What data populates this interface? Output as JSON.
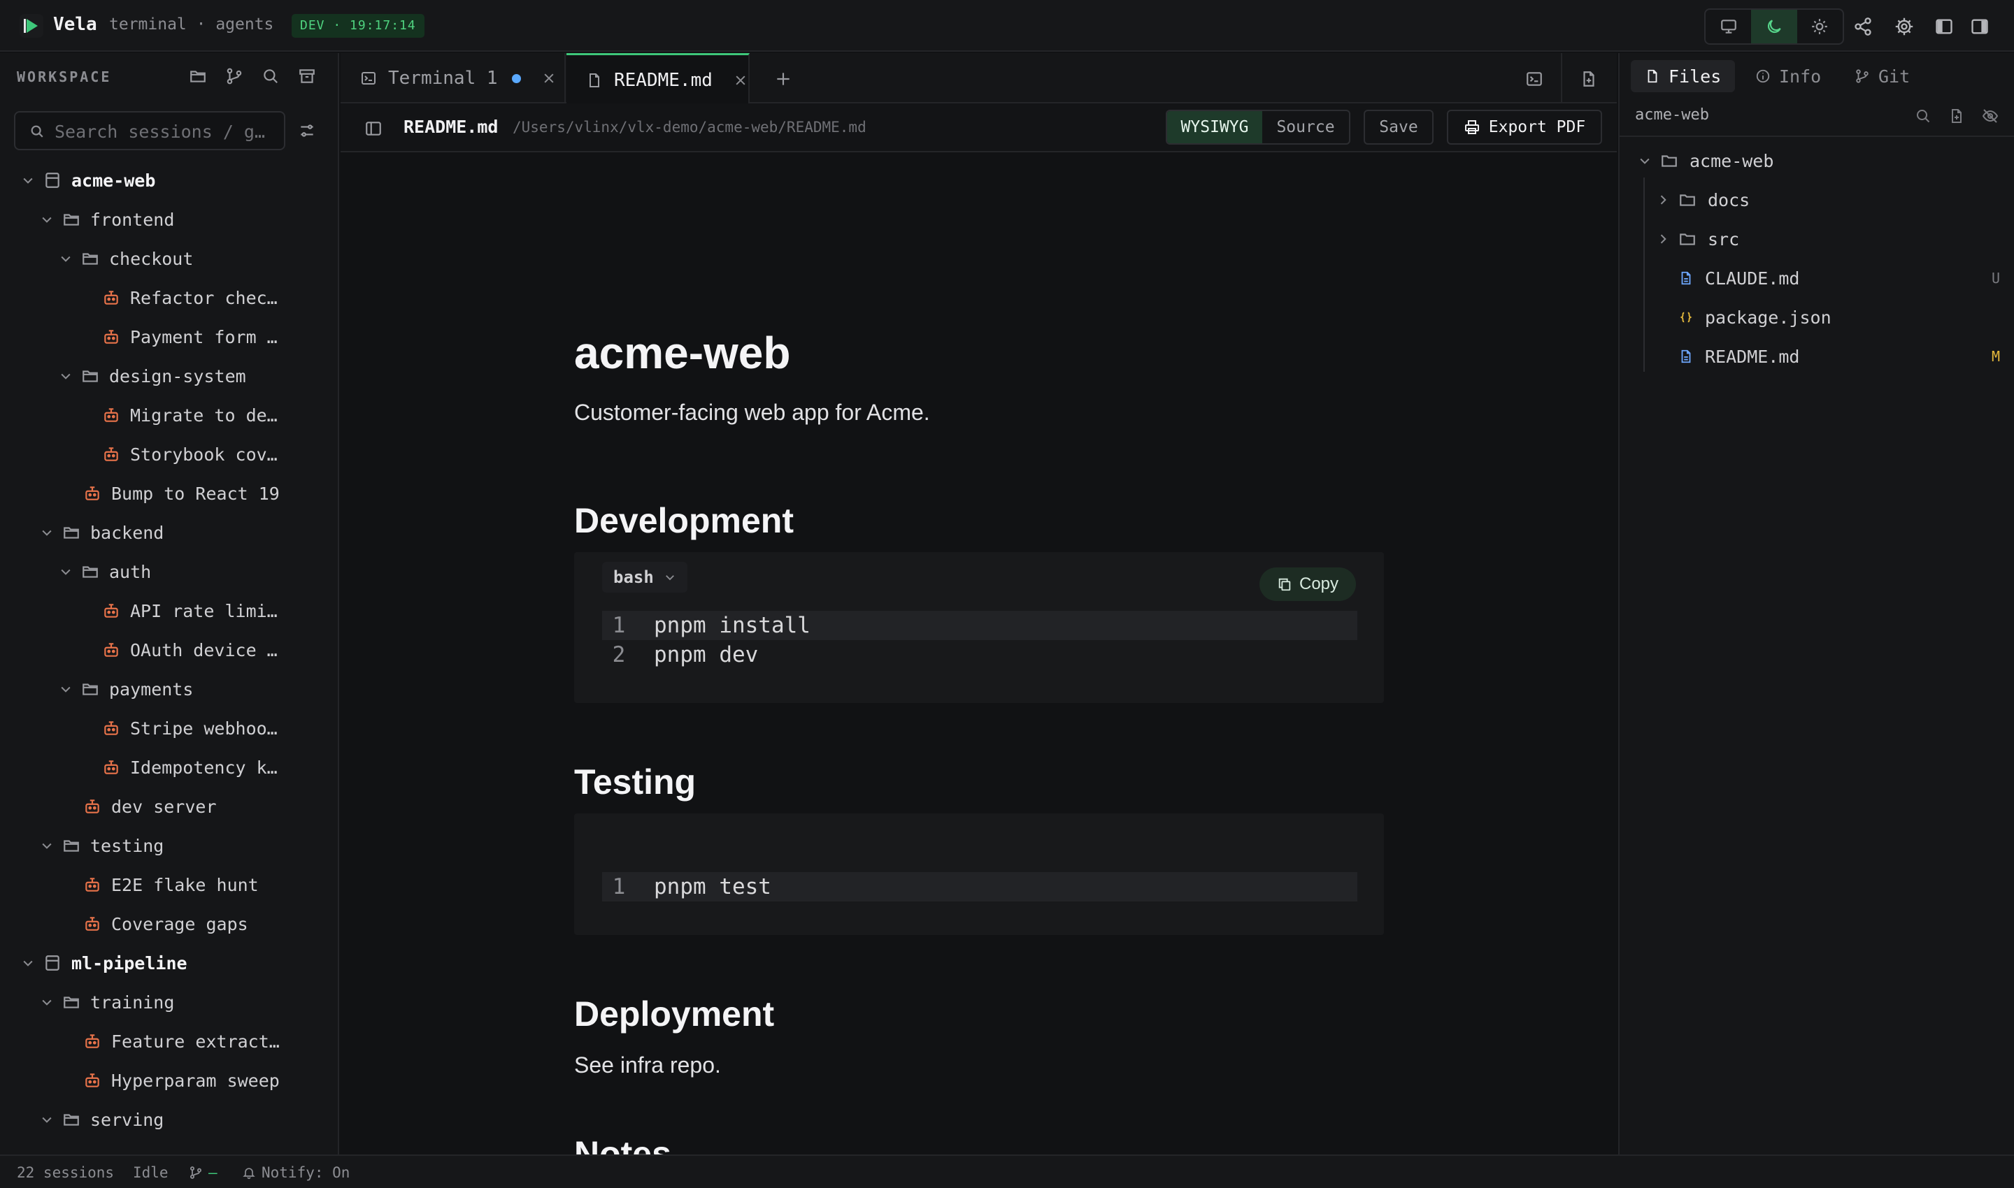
{
  "app": {
    "name": "Vela",
    "subtitle": "terminal · agents",
    "badge": "DEV · 19:17:14",
    "accent": "#3ec77a",
    "session_icon_color": "#e8734a"
  },
  "sidebar": {
    "title": "WORKSPACE",
    "search_placeholder": "Search sessions / g…",
    "tree": [
      {
        "kind": "project",
        "label": "acme-web",
        "depth": 0
      },
      {
        "kind": "folder",
        "label": "frontend",
        "depth": 1
      },
      {
        "kind": "folder",
        "label": "checkout",
        "depth": 2
      },
      {
        "kind": "session",
        "label": "Refactor chec…",
        "depth": 3
      },
      {
        "kind": "session",
        "label": "Payment form …",
        "depth": 3
      },
      {
        "kind": "folder",
        "label": "design-system",
        "depth": 2
      },
      {
        "kind": "session",
        "label": "Migrate to de…",
        "depth": 3
      },
      {
        "kind": "session",
        "label": "Storybook cov…",
        "depth": 3
      },
      {
        "kind": "session",
        "label": "Bump to React 19",
        "depth": 2
      },
      {
        "kind": "folder",
        "label": "backend",
        "depth": 1
      },
      {
        "kind": "folder",
        "label": "auth",
        "depth": 2
      },
      {
        "kind": "session",
        "label": "API rate limi…",
        "depth": 3
      },
      {
        "kind": "session",
        "label": "OAuth device …",
        "depth": 3
      },
      {
        "kind": "folder",
        "label": "payments",
        "depth": 2
      },
      {
        "kind": "session",
        "label": "Stripe webhoo…",
        "depth": 3
      },
      {
        "kind": "session",
        "label": "Idempotency k…",
        "depth": 3
      },
      {
        "kind": "session",
        "label": "dev server",
        "depth": 2
      },
      {
        "kind": "folder",
        "label": "testing",
        "depth": 1
      },
      {
        "kind": "session",
        "label": "E2E flake hunt",
        "depth": 2
      },
      {
        "kind": "session",
        "label": "Coverage gaps",
        "depth": 2
      },
      {
        "kind": "project",
        "label": "ml-pipeline",
        "depth": 0
      },
      {
        "kind": "folder",
        "label": "training",
        "depth": 1
      },
      {
        "kind": "session",
        "label": "Feature extract…",
        "depth": 2
      },
      {
        "kind": "session",
        "label": "Hyperparam sweep",
        "depth": 2
      },
      {
        "kind": "folder",
        "label": "serving",
        "depth": 1
      }
    ]
  },
  "tabs": {
    "terminal_label": "Terminal 1",
    "readme_label": "README.md"
  },
  "doc_toolbar": {
    "file_name": "README.md",
    "file_path": "/Users/vlinx/vlx-demo/acme-web/README.md",
    "mode_wysiwyg": "WYSIWYG",
    "mode_source": "Source",
    "save_label": "Save",
    "export_label": "Export PDF"
  },
  "document": {
    "title": "acme-web",
    "intro": "Customer-facing web app for Acme.",
    "dev_heading": "Development",
    "dev_lang": "bash",
    "copy_label": "Copy",
    "dev_lines": [
      {
        "num": "1",
        "code": "pnpm install"
      },
      {
        "num": "2",
        "code": "pnpm dev"
      }
    ],
    "testing_heading": "Testing",
    "test_lines": [
      {
        "num": "1",
        "code": "pnpm test"
      }
    ],
    "deploy_heading": "Deployment",
    "deploy_text": "See infra repo.",
    "notes_heading": "Notes"
  },
  "right_panel": {
    "tab_files": "Files",
    "tab_info": "Info",
    "tab_git": "Git",
    "root_label": "acme-web",
    "files": [
      {
        "kind": "root-folder",
        "label": "acme-web",
        "status": ""
      },
      {
        "kind": "folder",
        "label": "docs",
        "status": ""
      },
      {
        "kind": "folder",
        "label": "src",
        "status": ""
      },
      {
        "kind": "md",
        "label": "CLAUDE.md",
        "status": "U"
      },
      {
        "kind": "json",
        "label": "package.json",
        "status": ""
      },
      {
        "kind": "md",
        "label": "README.md",
        "status": "M"
      }
    ],
    "status_colors": {
      "U": "#7a7b80",
      "M": "#e5b93c"
    }
  },
  "statusbar": {
    "sessions": "22 sessions",
    "state": "Idle",
    "branch": "—",
    "notify": "Notify: On"
  }
}
